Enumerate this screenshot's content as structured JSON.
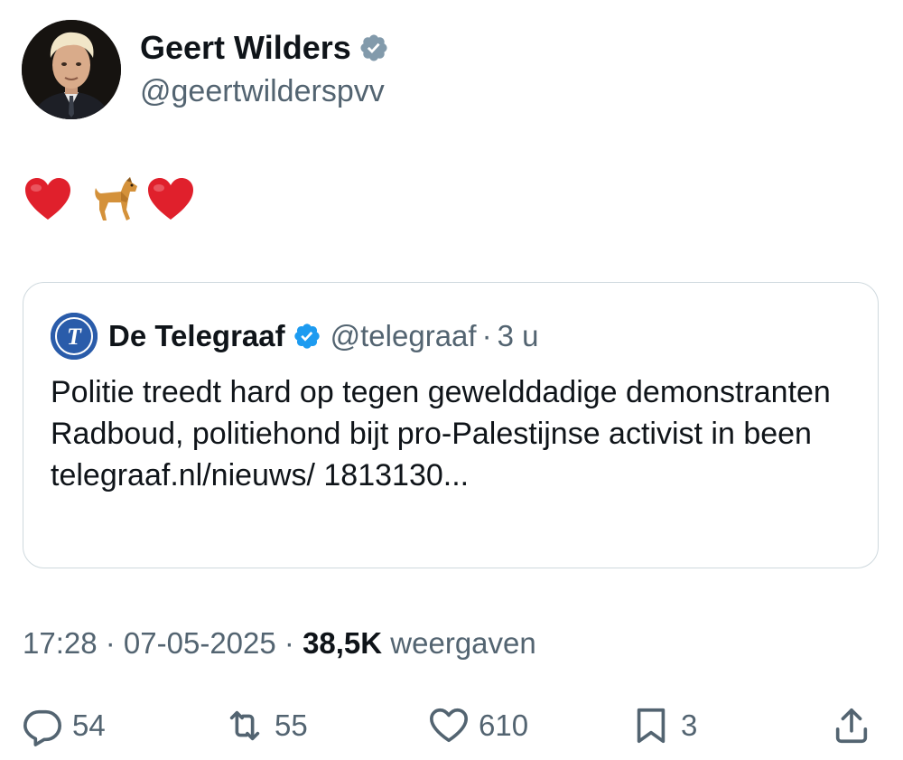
{
  "author": {
    "name": "Geert Wilders",
    "handle": "@geertwilderspvv",
    "verified_color": "#829aab",
    "avatar_icon": "profile-photo"
  },
  "tweet": {
    "emojis": [
      "red-heart-icon",
      "dog-icon",
      "red-heart-icon"
    ]
  },
  "quote": {
    "name": "De Telegraaf",
    "handle": "@telegraaf",
    "separator": "·",
    "time": "3 u",
    "logo_letter": "T",
    "text": "Politie treedt hard op tegen gewelddadige demonstranten Radboud, politiehond bijt pro-Palestijnse activist in been telegraaf.nl/nieuws/ 1813130...",
    "verified_color": "#1d9bf0"
  },
  "meta": {
    "time": "17:28",
    "separator1": " · ",
    "date": "07-05-2025",
    "separator2": " · ",
    "views_count": "38,5K",
    "views_label": " weergaven"
  },
  "actions": {
    "replies": "54",
    "reposts": "55",
    "likes": "610",
    "bookmarks": "3"
  },
  "colors": {
    "text_primary": "#0f1419",
    "text_secondary": "#536471",
    "border": "#cfd9de",
    "heart": "#e0202c"
  }
}
